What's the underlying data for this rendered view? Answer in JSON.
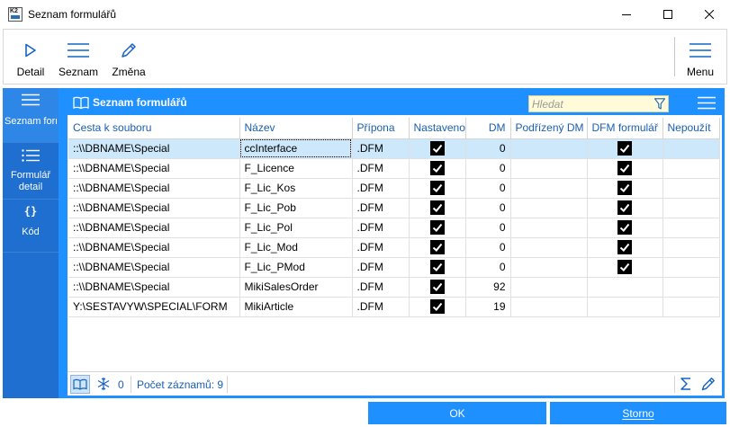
{
  "window": {
    "title": "Seznam formulářů",
    "logo_text": "K2"
  },
  "toolbar": {
    "detail_label": "Detail",
    "seznam_label": "Seznam",
    "zmena_label": "Změna",
    "menu_label": "Menu"
  },
  "leftnav": {
    "items": [
      {
        "label": "Seznam formulá...",
        "icon": "list-icon",
        "active": true
      },
      {
        "label": "Formulář detail",
        "icon": "list-detail-icon",
        "active": false
      },
      {
        "label": "Kód",
        "icon": "code-braces-icon",
        "icon_text": "{}",
        "active": false
      }
    ]
  },
  "panel": {
    "title": "Seznam formulářů",
    "search_placeholder": "Hledat"
  },
  "table": {
    "columns": [
      "Cesta k souboru",
      "Název",
      "Přípona",
      "Nastaveno",
      "DM",
      "Podřízený DM",
      "DFM formulář",
      "Nepoužít"
    ],
    "rows": [
      {
        "path": "::\\\\DBNAME\\Special",
        "name": "ccInterface",
        "ext": ".DFM",
        "nastaveno": true,
        "dm": "0",
        "podrizeny_dm": "",
        "dfm": true,
        "nepouzit": false
      },
      {
        "path": "::\\\\DBNAME\\Special",
        "name": "F_Licence",
        "ext": ".DFM",
        "nastaveno": true,
        "dm": "0",
        "podrizeny_dm": "",
        "dfm": true,
        "nepouzit": false
      },
      {
        "path": "::\\\\DBNAME\\Special",
        "name": "F_Lic_Kos",
        "ext": ".DFM",
        "nastaveno": true,
        "dm": "0",
        "podrizeny_dm": "",
        "dfm": true,
        "nepouzit": false
      },
      {
        "path": "::\\\\DBNAME\\Special",
        "name": "F_Lic_Pob",
        "ext": ".DFM",
        "nastaveno": true,
        "dm": "0",
        "podrizeny_dm": "",
        "dfm": true,
        "nepouzit": false
      },
      {
        "path": "::\\\\DBNAME\\Special",
        "name": "F_Lic_Pol",
        "ext": ".DFM",
        "nastaveno": true,
        "dm": "0",
        "podrizeny_dm": "",
        "dfm": true,
        "nepouzit": false
      },
      {
        "path": "::\\\\DBNAME\\Special",
        "name": "F_Lic_Mod",
        "ext": ".DFM",
        "nastaveno": true,
        "dm": "0",
        "podrizeny_dm": "",
        "dfm": true,
        "nepouzit": false
      },
      {
        "path": "::\\\\DBNAME\\Special",
        "name": "F_Lic_PMod",
        "ext": ".DFM",
        "nastaveno": true,
        "dm": "0",
        "podrizeny_dm": "",
        "dfm": true,
        "nepouzit": false
      },
      {
        "path": "::\\\\DBNAME\\Special",
        "name": "MikiSalesOrder",
        "ext": ".DFM",
        "nastaveno": true,
        "dm": "92",
        "podrizeny_dm": "",
        "dfm": false,
        "nepouzit": false
      },
      {
        "path": "Y:\\SESTAVYW\\SPECIAL\\FORM",
        "name": "MikiArticle",
        "ext": ".DFM",
        "nastaveno": true,
        "dm": "19",
        "podrizeny_dm": "",
        "dfm": false,
        "nepouzit": false
      }
    ]
  },
  "statusbar": {
    "selected_count": "0",
    "records_label": "Počet záznamů: 9"
  },
  "buttons": {
    "ok_label": "OK",
    "storno_label": "Storno"
  },
  "colors": {
    "accent": "#1e90ff",
    "nav_bg": "#1f6fd0",
    "nav_active": "#2e86e6",
    "selected_row": "#cce8fa",
    "header_text": "#1a5fb4",
    "search_bg": "#fffbd8"
  }
}
